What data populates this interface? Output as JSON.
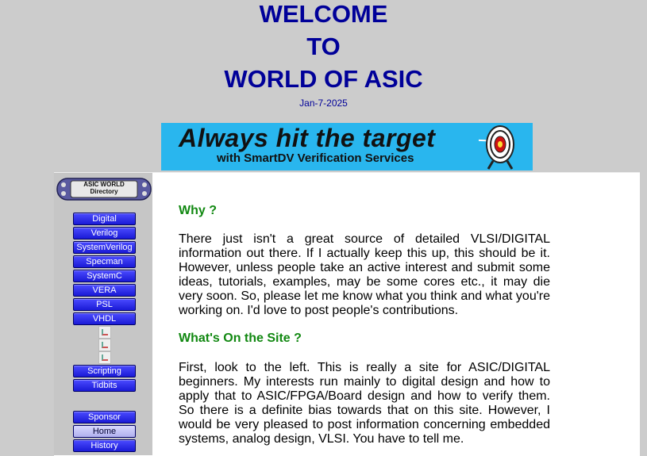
{
  "header": {
    "line1": "WELCOME",
    "line2": "TO",
    "line3": "WORLD OF ASIC",
    "date": "Jan-7-2025"
  },
  "banner": {
    "headline": "Always hit the target",
    "subline": "with SmartDV Verification Services"
  },
  "sidebar": {
    "directory_logo_line1": "ASIC WORLD",
    "directory_logo_line2": "Directory",
    "items": [
      {
        "label": "Digital"
      },
      {
        "label": "Verilog"
      },
      {
        "label": "SystemVerilog"
      },
      {
        "label": "Specman"
      },
      {
        "label": "SystemC"
      },
      {
        "label": "VERA"
      },
      {
        "label": "PSL"
      },
      {
        "label": "VHDL"
      },
      {
        "label": "Scripting"
      },
      {
        "label": "Tidbits"
      },
      {
        "label": "Sponsor"
      },
      {
        "label": "Home"
      },
      {
        "label": "History"
      }
    ]
  },
  "main": {
    "section1_title": "Why ?",
    "section1_text": "There just isn't a great source of detailed VLSI/DIGITAL information out there. If I actually keep this up, this should be it. However, unless people take an active interest and submit some ideas, tutorials, examples, may be some cores etc., it may die very soon. So, please let me know what you think and what you're working on. I'd love to post people's contributions.",
    "section2_title": "What's On the Site ?",
    "section2_text": "First, look to the left. This is really a site for ASIC/DIGITAL beginners. My interests run mainly to digital design and how to apply that to ASIC/FPGA/Board design and how to verify them. So there is a definite bias towards that on this site. However, I would be very pleased to post information concerning embedded systems, analog design, VLSI. You have to tell me."
  },
  "colors": {
    "background": "#cccccc",
    "heading_blue": "#000099",
    "section_green": "#118811",
    "banner_blue": "#29b6ee",
    "nav_button": "#2a2ae6"
  }
}
